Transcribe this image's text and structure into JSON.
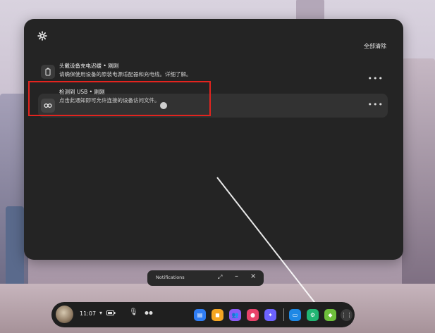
{
  "panel": {
    "clear_all": "全部清除",
    "notifications": [
      {
        "title": "头戴设备充电迟缓 • 刚刚",
        "description": "请确保使用设备的原装电源适配器和充电线。详细了解。",
        "icon": "battery-icon"
      },
      {
        "title": "检测到 USB • 刚刚",
        "description": "点击此通知即可允许连接的设备访问文件。",
        "icon": "usb-icon",
        "highlighted": true
      }
    ]
  },
  "mini_bar": {
    "label": "Notifications"
  },
  "dock": {
    "time": "11:07",
    "apps": [
      {
        "name": "store-app-icon",
        "color": "#2f7df5"
      },
      {
        "name": "app-orange-icon",
        "color": "#f5a623"
      },
      {
        "name": "people-app-icon",
        "color": "#8a5cf6"
      },
      {
        "name": "camera-app-icon",
        "color": "#e8436a"
      },
      {
        "name": "explore-app-icon",
        "color": "#6c63ff"
      },
      {
        "name": "tv-app-icon",
        "color": "#1e88e5"
      },
      {
        "name": "settings-app-icon",
        "color": "#21b573"
      },
      {
        "name": "android-app-icon",
        "color": "#6ebf3b"
      },
      {
        "name": "app-library-icon",
        "color": "#3a3a3a"
      }
    ]
  },
  "colors": {
    "highlight": "#e3241f",
    "panel": "#242424"
  }
}
